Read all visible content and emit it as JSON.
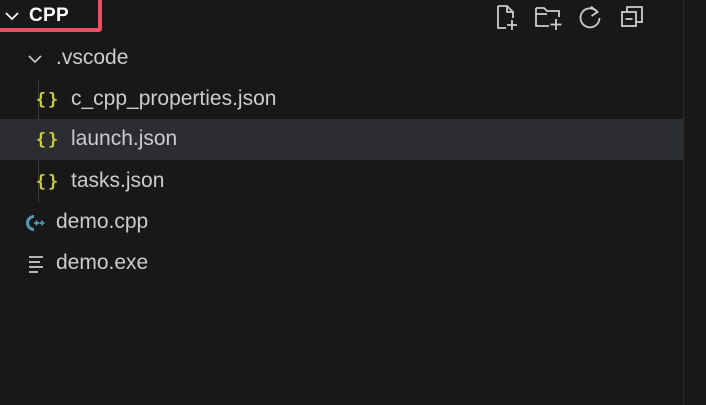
{
  "section": {
    "title": "CPP"
  },
  "toolbar": {
    "icons": [
      "new-file-icon",
      "new-folder-icon",
      "refresh-icon",
      "collapse-all-icon"
    ]
  },
  "tree": {
    "folder": ".vscode",
    "files": {
      "c_cpp_properties": "c_cpp_properties.json",
      "launch": "launch.json",
      "tasks": "tasks.json",
      "demo_cpp": "demo.cpp",
      "demo_exe": "demo.exe"
    },
    "json_glyph": "{}"
  },
  "colors": {
    "background": "#181818",
    "selected_row": "#2b2d31",
    "highlight_border": "#ee4e5f",
    "json_icon": "#cbcb41",
    "cpp_icon": "#519aba",
    "text": "#cccccc"
  }
}
